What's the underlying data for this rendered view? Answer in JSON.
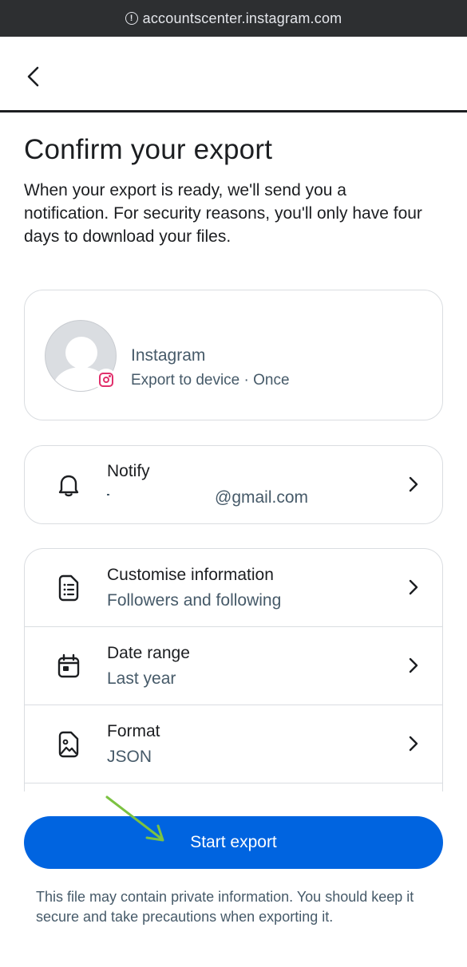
{
  "browser": {
    "url": "accountscenter.instagram.com",
    "info_glyph": "!"
  },
  "page": {
    "title": "Confirm your export",
    "description": "When your export is ready, we'll send you a notification. For security reasons, you'll only have four days to download your files."
  },
  "account": {
    "name": "Instagram",
    "subtitle": "Export to device · Once",
    "badge_icon": "instagram-icon",
    "avatar_icon": "default-avatar"
  },
  "notify": {
    "title": "Notify",
    "email": "@gmail.com",
    "icon": "bell-icon"
  },
  "options": [
    {
      "title": "Customise information",
      "value": "Followers and following",
      "icon": "document-list-icon"
    },
    {
      "title": "Date range",
      "value": "Last year",
      "icon": "calendar-icon"
    },
    {
      "title": "Format",
      "value": "JSON",
      "icon": "image-file-icon"
    }
  ],
  "actions": {
    "start_export": "Start export"
  },
  "footer": {
    "note": "This file may contain private information. You should keep it secure and take precautions when exporting it."
  },
  "colors": {
    "primary": "#0064e0",
    "text": "#1c1e21",
    "secondary_text": "#465a69",
    "border": "#dadde1",
    "url_bar": "#2d2f31",
    "annotation_arrow": "#7cc242",
    "instagram": "#e1306c"
  }
}
